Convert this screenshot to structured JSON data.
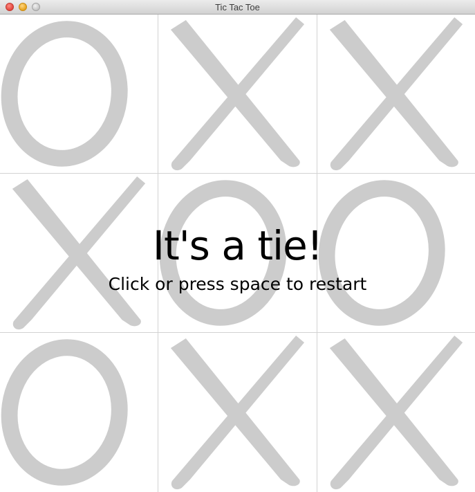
{
  "window": {
    "title": "Tic Tac Toe"
  },
  "board": {
    "cells": [
      "O",
      "X",
      "X",
      "X",
      "O",
      "O",
      "O",
      "X",
      "X"
    ]
  },
  "colors": {
    "mark": "#cccccc",
    "grid": "#d2d2d2",
    "text": "#000000"
  },
  "message": {
    "result": "It's a tie!",
    "hint": "Click or press space to restart"
  }
}
